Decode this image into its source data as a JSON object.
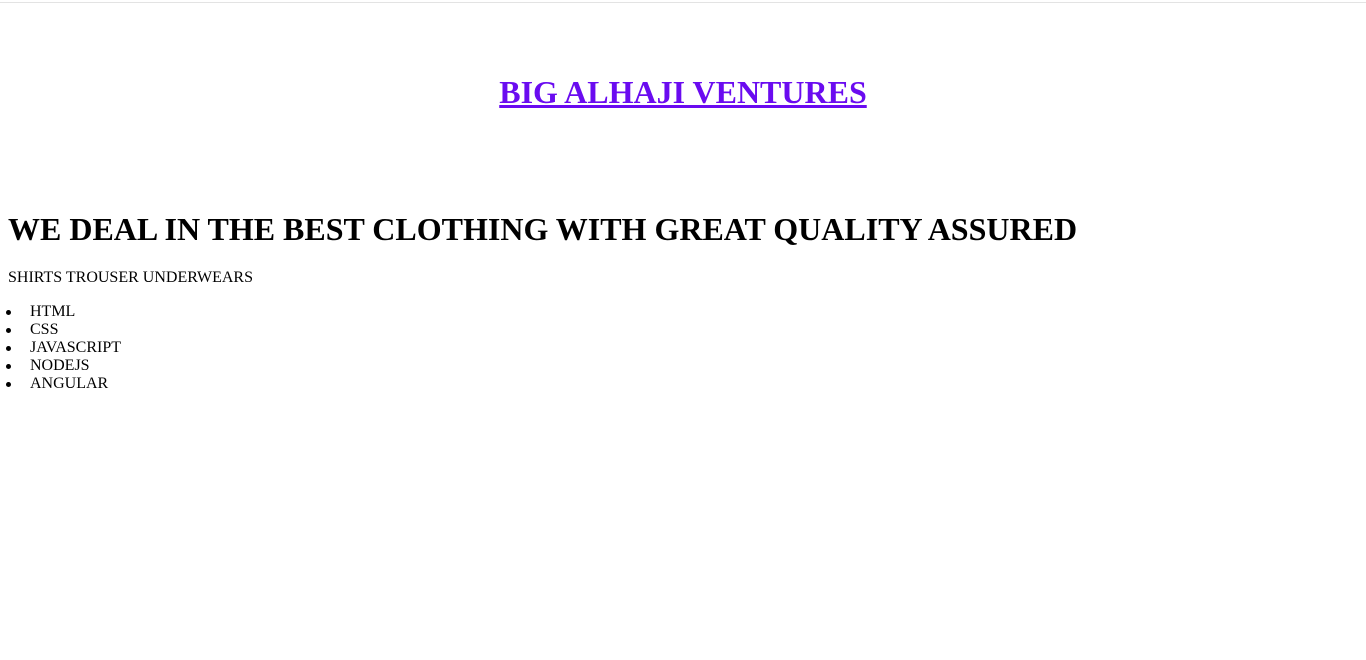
{
  "header": {
    "brand": "BIG ALHAJI VENTURES",
    "brand_color": "#6a0bf0"
  },
  "main": {
    "headline": "WE DEAL IN THE BEST CLOTHING WITH GREAT QUALITY ASSURED",
    "categories": "SHIRTS TROUSER UNDERWEARS",
    "list_items": [
      "HTML",
      "CSS",
      "JAVASCRIPT",
      "NODEJS",
      "ANGULAR"
    ]
  }
}
